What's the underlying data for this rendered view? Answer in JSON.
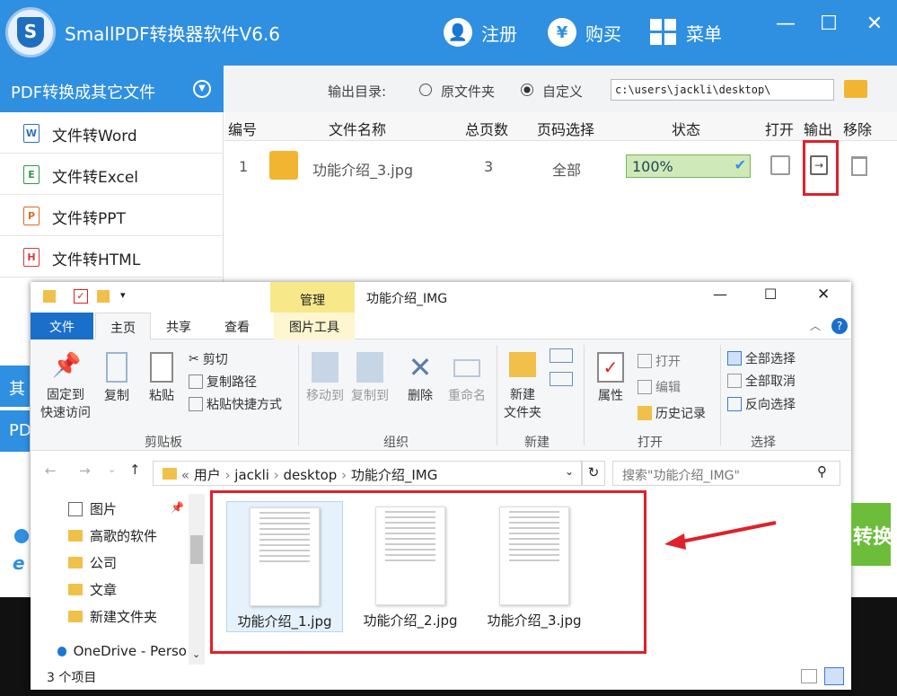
{
  "app": {
    "title": "SmallPDF转换器软件V6.6",
    "logo_letter": "S",
    "register": "注册",
    "buy": "购买",
    "menu": "菜单",
    "buy_glyph": "¥",
    "minimize": "—",
    "maximize": "☐",
    "close": "✕"
  },
  "sidebar": {
    "header": "PDF转换成其它文件",
    "items": [
      {
        "label": "文件转Word",
        "icon": "W",
        "color": "#2b6ecb"
      },
      {
        "label": "文件转Excel",
        "icon": "E",
        "color": "#2a9b4a"
      },
      {
        "label": "文件转PPT",
        "icon": "P",
        "color": "#d86b2a"
      },
      {
        "label": "文件转HTML",
        "icon": "H",
        "color": "#d43a3a"
      }
    ],
    "partial_1": "其",
    "partial_2": "PD"
  },
  "output": {
    "label": "输出目录:",
    "opt_original": "原文件夹",
    "opt_custom": "自定义",
    "path": "c:\\users\\jackli\\desktop\\"
  },
  "table": {
    "headers": [
      "编号",
      "文件名称",
      "总页数",
      "页码选择",
      "状态",
      "打开",
      "输出",
      "移除"
    ],
    "rows": [
      {
        "num": "1",
        "name": "功能介绍_3.jpg",
        "pages": "3",
        "range": "全部",
        "progress": "100%"
      }
    ]
  },
  "explorer": {
    "title": "功能介绍_IMG",
    "manage_tab": "管理",
    "tabs": [
      "文件",
      "主页",
      "共享",
      "查看",
      "图片工具"
    ],
    "ribbon": {
      "pin": "固定到\n快速访问",
      "copy": "复制",
      "paste": "粘贴",
      "cut": "剪切",
      "copy_path": "复制路径",
      "paste_shortcut": "粘贴快捷方式",
      "move_to": "移动到",
      "copy_to": "复制到",
      "delete": "删除",
      "rename": "重命名",
      "new_folder": "新建\n文件夹",
      "properties": "属性",
      "open": "打开",
      "edit": "编辑",
      "history": "历史记录",
      "select_all": "全部选择",
      "select_none": "全部取消",
      "invert": "反向选择",
      "groups": [
        "剪贴板",
        "组织",
        "新建",
        "打开",
        "选择"
      ]
    },
    "breadcrumb": [
      "用户",
      "jackli",
      "desktop",
      "功能介绍_IMG"
    ],
    "search_placeholder": "搜索\"功能介绍_IMG\"",
    "nav": [
      "图片",
      "高歌的软件",
      "公司",
      "文章",
      "新建文件夹",
      "OneDrive - Perso"
    ],
    "files": [
      "功能介绍_1.jpg",
      "功能介绍_2.jpg",
      "功能介绍_3.jpg"
    ],
    "status": "3 个项目"
  },
  "partial_button": "转换"
}
